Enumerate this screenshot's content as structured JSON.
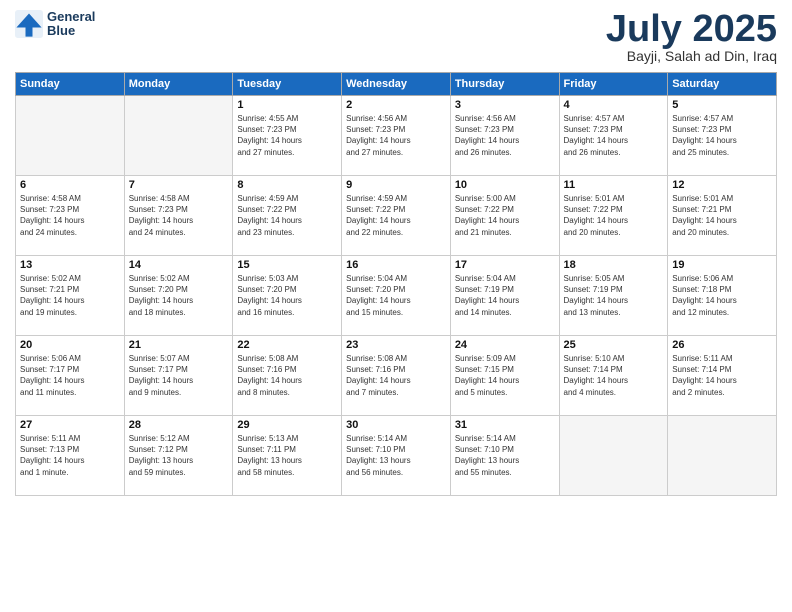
{
  "header": {
    "logo_line1": "General",
    "logo_line2": "Blue",
    "month": "July 2025",
    "location": "Bayji, Salah ad Din, Iraq"
  },
  "weekdays": [
    "Sunday",
    "Monday",
    "Tuesday",
    "Wednesday",
    "Thursday",
    "Friday",
    "Saturday"
  ],
  "weeks": [
    [
      {
        "day": "",
        "info": ""
      },
      {
        "day": "",
        "info": ""
      },
      {
        "day": "1",
        "info": "Sunrise: 4:55 AM\nSunset: 7:23 PM\nDaylight: 14 hours\nand 27 minutes."
      },
      {
        "day": "2",
        "info": "Sunrise: 4:56 AM\nSunset: 7:23 PM\nDaylight: 14 hours\nand 27 minutes."
      },
      {
        "day": "3",
        "info": "Sunrise: 4:56 AM\nSunset: 7:23 PM\nDaylight: 14 hours\nand 26 minutes."
      },
      {
        "day": "4",
        "info": "Sunrise: 4:57 AM\nSunset: 7:23 PM\nDaylight: 14 hours\nand 26 minutes."
      },
      {
        "day": "5",
        "info": "Sunrise: 4:57 AM\nSunset: 7:23 PM\nDaylight: 14 hours\nand 25 minutes."
      }
    ],
    [
      {
        "day": "6",
        "info": "Sunrise: 4:58 AM\nSunset: 7:23 PM\nDaylight: 14 hours\nand 24 minutes."
      },
      {
        "day": "7",
        "info": "Sunrise: 4:58 AM\nSunset: 7:23 PM\nDaylight: 14 hours\nand 24 minutes."
      },
      {
        "day": "8",
        "info": "Sunrise: 4:59 AM\nSunset: 7:22 PM\nDaylight: 14 hours\nand 23 minutes."
      },
      {
        "day": "9",
        "info": "Sunrise: 4:59 AM\nSunset: 7:22 PM\nDaylight: 14 hours\nand 22 minutes."
      },
      {
        "day": "10",
        "info": "Sunrise: 5:00 AM\nSunset: 7:22 PM\nDaylight: 14 hours\nand 21 minutes."
      },
      {
        "day": "11",
        "info": "Sunrise: 5:01 AM\nSunset: 7:22 PM\nDaylight: 14 hours\nand 20 minutes."
      },
      {
        "day": "12",
        "info": "Sunrise: 5:01 AM\nSunset: 7:21 PM\nDaylight: 14 hours\nand 20 minutes."
      }
    ],
    [
      {
        "day": "13",
        "info": "Sunrise: 5:02 AM\nSunset: 7:21 PM\nDaylight: 14 hours\nand 19 minutes."
      },
      {
        "day": "14",
        "info": "Sunrise: 5:02 AM\nSunset: 7:20 PM\nDaylight: 14 hours\nand 18 minutes."
      },
      {
        "day": "15",
        "info": "Sunrise: 5:03 AM\nSunset: 7:20 PM\nDaylight: 14 hours\nand 16 minutes."
      },
      {
        "day": "16",
        "info": "Sunrise: 5:04 AM\nSunset: 7:20 PM\nDaylight: 14 hours\nand 15 minutes."
      },
      {
        "day": "17",
        "info": "Sunrise: 5:04 AM\nSunset: 7:19 PM\nDaylight: 14 hours\nand 14 minutes."
      },
      {
        "day": "18",
        "info": "Sunrise: 5:05 AM\nSunset: 7:19 PM\nDaylight: 14 hours\nand 13 minutes."
      },
      {
        "day": "19",
        "info": "Sunrise: 5:06 AM\nSunset: 7:18 PM\nDaylight: 14 hours\nand 12 minutes."
      }
    ],
    [
      {
        "day": "20",
        "info": "Sunrise: 5:06 AM\nSunset: 7:17 PM\nDaylight: 14 hours\nand 11 minutes."
      },
      {
        "day": "21",
        "info": "Sunrise: 5:07 AM\nSunset: 7:17 PM\nDaylight: 14 hours\nand 9 minutes."
      },
      {
        "day": "22",
        "info": "Sunrise: 5:08 AM\nSunset: 7:16 PM\nDaylight: 14 hours\nand 8 minutes."
      },
      {
        "day": "23",
        "info": "Sunrise: 5:08 AM\nSunset: 7:16 PM\nDaylight: 14 hours\nand 7 minutes."
      },
      {
        "day": "24",
        "info": "Sunrise: 5:09 AM\nSunset: 7:15 PM\nDaylight: 14 hours\nand 5 minutes."
      },
      {
        "day": "25",
        "info": "Sunrise: 5:10 AM\nSunset: 7:14 PM\nDaylight: 14 hours\nand 4 minutes."
      },
      {
        "day": "26",
        "info": "Sunrise: 5:11 AM\nSunset: 7:14 PM\nDaylight: 14 hours\nand 2 minutes."
      }
    ],
    [
      {
        "day": "27",
        "info": "Sunrise: 5:11 AM\nSunset: 7:13 PM\nDaylight: 14 hours\nand 1 minute."
      },
      {
        "day": "28",
        "info": "Sunrise: 5:12 AM\nSunset: 7:12 PM\nDaylight: 13 hours\nand 59 minutes."
      },
      {
        "day": "29",
        "info": "Sunrise: 5:13 AM\nSunset: 7:11 PM\nDaylight: 13 hours\nand 58 minutes."
      },
      {
        "day": "30",
        "info": "Sunrise: 5:14 AM\nSunset: 7:10 PM\nDaylight: 13 hours\nand 56 minutes."
      },
      {
        "day": "31",
        "info": "Sunrise: 5:14 AM\nSunset: 7:10 PM\nDaylight: 13 hours\nand 55 minutes."
      },
      {
        "day": "",
        "info": ""
      },
      {
        "day": "",
        "info": ""
      }
    ]
  ]
}
